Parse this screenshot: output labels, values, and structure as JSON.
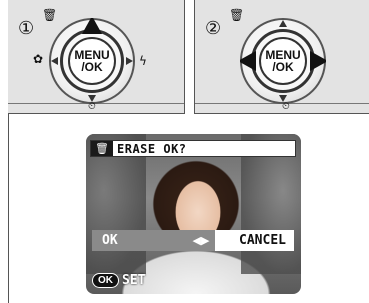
{
  "steps": [
    {
      "number": "①",
      "dial_label_line1": "MENU",
      "dial_label_line2": "/OK",
      "highlight": "up"
    },
    {
      "number": "②",
      "dial_label_line1": "MENU",
      "dial_label_line2": "/OK",
      "highlight": "left-right"
    }
  ],
  "dial_icons": {
    "trash": "🗑",
    "macro": "✿",
    "flash": "ϟ",
    "timer": "⏲"
  },
  "screen": {
    "title_icon": "🗑",
    "title": "ERASE OK?",
    "ok_label": "OK",
    "arrows": "◀▶",
    "cancel_label": "CANCEL",
    "ok_button": "OK",
    "set_label": "SET"
  },
  "colors": {
    "panel_bg": "#e3e3e3",
    "selected_option": "#8a8a8a",
    "title_bar_icon_bg": "#1a1a1a"
  }
}
